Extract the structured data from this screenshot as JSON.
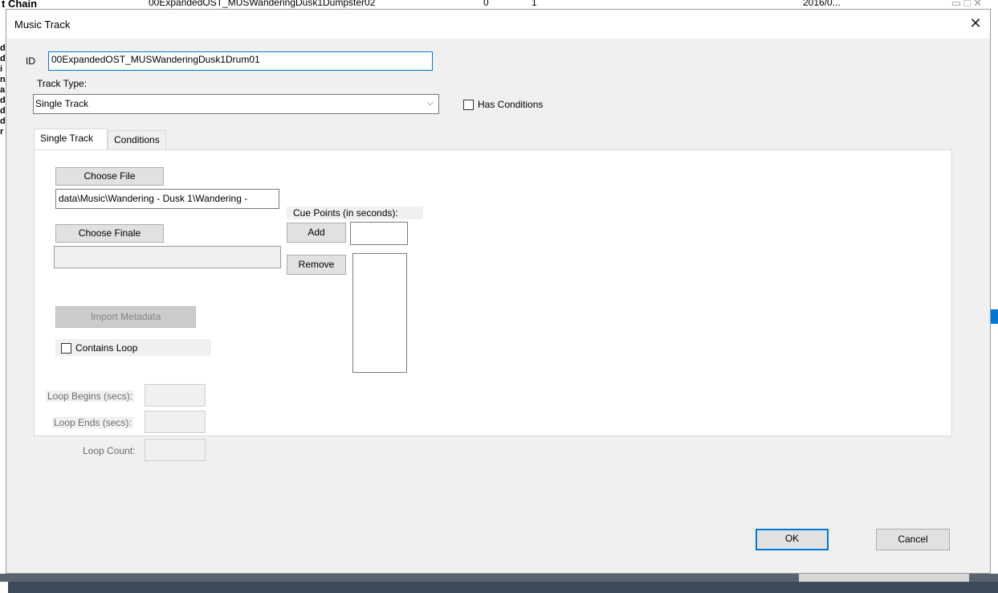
{
  "background": {
    "header_title": "t Chain",
    "row_name": "00ExpandedOST_MUSWanderingDusk1Dumpster02",
    "row_col2": "0",
    "row_col3": "1",
    "row_col4": "2016/0..."
  },
  "dialog": {
    "title": "Music Track",
    "close_label": "✕"
  },
  "form": {
    "id_label": "ID",
    "id_value": "00ExpandedOST_MUSWanderingDusk1Drum01",
    "track_type_label": "Track Type:",
    "track_type_value": "Single Track",
    "has_conditions_label": "Has Conditions"
  },
  "tabs": [
    {
      "label": "Single Track",
      "active": true
    },
    {
      "label": "Conditions",
      "active": false
    }
  ],
  "single_track": {
    "choose_file_label": "Choose File",
    "file_path": "data\\Music\\Wandering - Dusk 1\\Wandering -",
    "choose_finale_label": "Choose Finale",
    "finale_path": "",
    "import_metadata_label": "Import Metadata",
    "contains_loop_label": "Contains Loop",
    "cue_points_label": "Cue Points (in seconds):",
    "add_label": "Add",
    "remove_label": "Remove",
    "cue_value": "",
    "loop_begins_label": "Loop Begins (secs):",
    "loop_ends_label": "Loop Ends (secs):",
    "loop_count_label": "Loop Count:"
  },
  "footer": {
    "ok_label": "OK",
    "cancel_label": "Cancel"
  },
  "colors": {
    "accent": "#0078d7",
    "dialog_bg": "#f0f0f0"
  }
}
